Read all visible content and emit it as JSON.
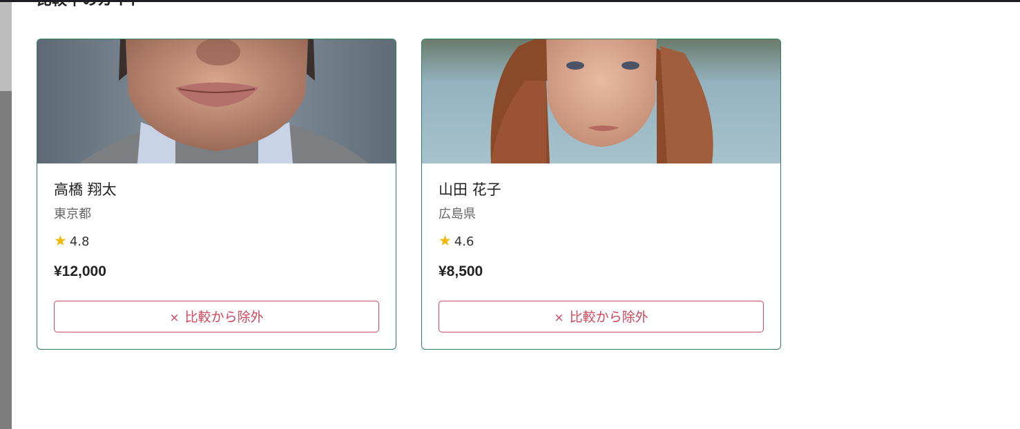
{
  "modal": {
    "title": "比較中のガイド"
  },
  "guides": [
    {
      "name": "高橋 翔太",
      "prefecture": "東京都",
      "rating": "4.8",
      "price": "¥12,000",
      "remove_label": "比較から除外",
      "remove_icon": "×"
    },
    {
      "name": "山田 花子",
      "prefecture": "広島県",
      "rating": "4.6",
      "price": "¥8,500",
      "remove_label": "比較から除外",
      "remove_icon": "×"
    }
  ],
  "icons": {
    "star": "★",
    "star_color": "#f5b800"
  },
  "colors": {
    "card_border": "#2e7d5b",
    "remove_accent": "#d6455b"
  }
}
